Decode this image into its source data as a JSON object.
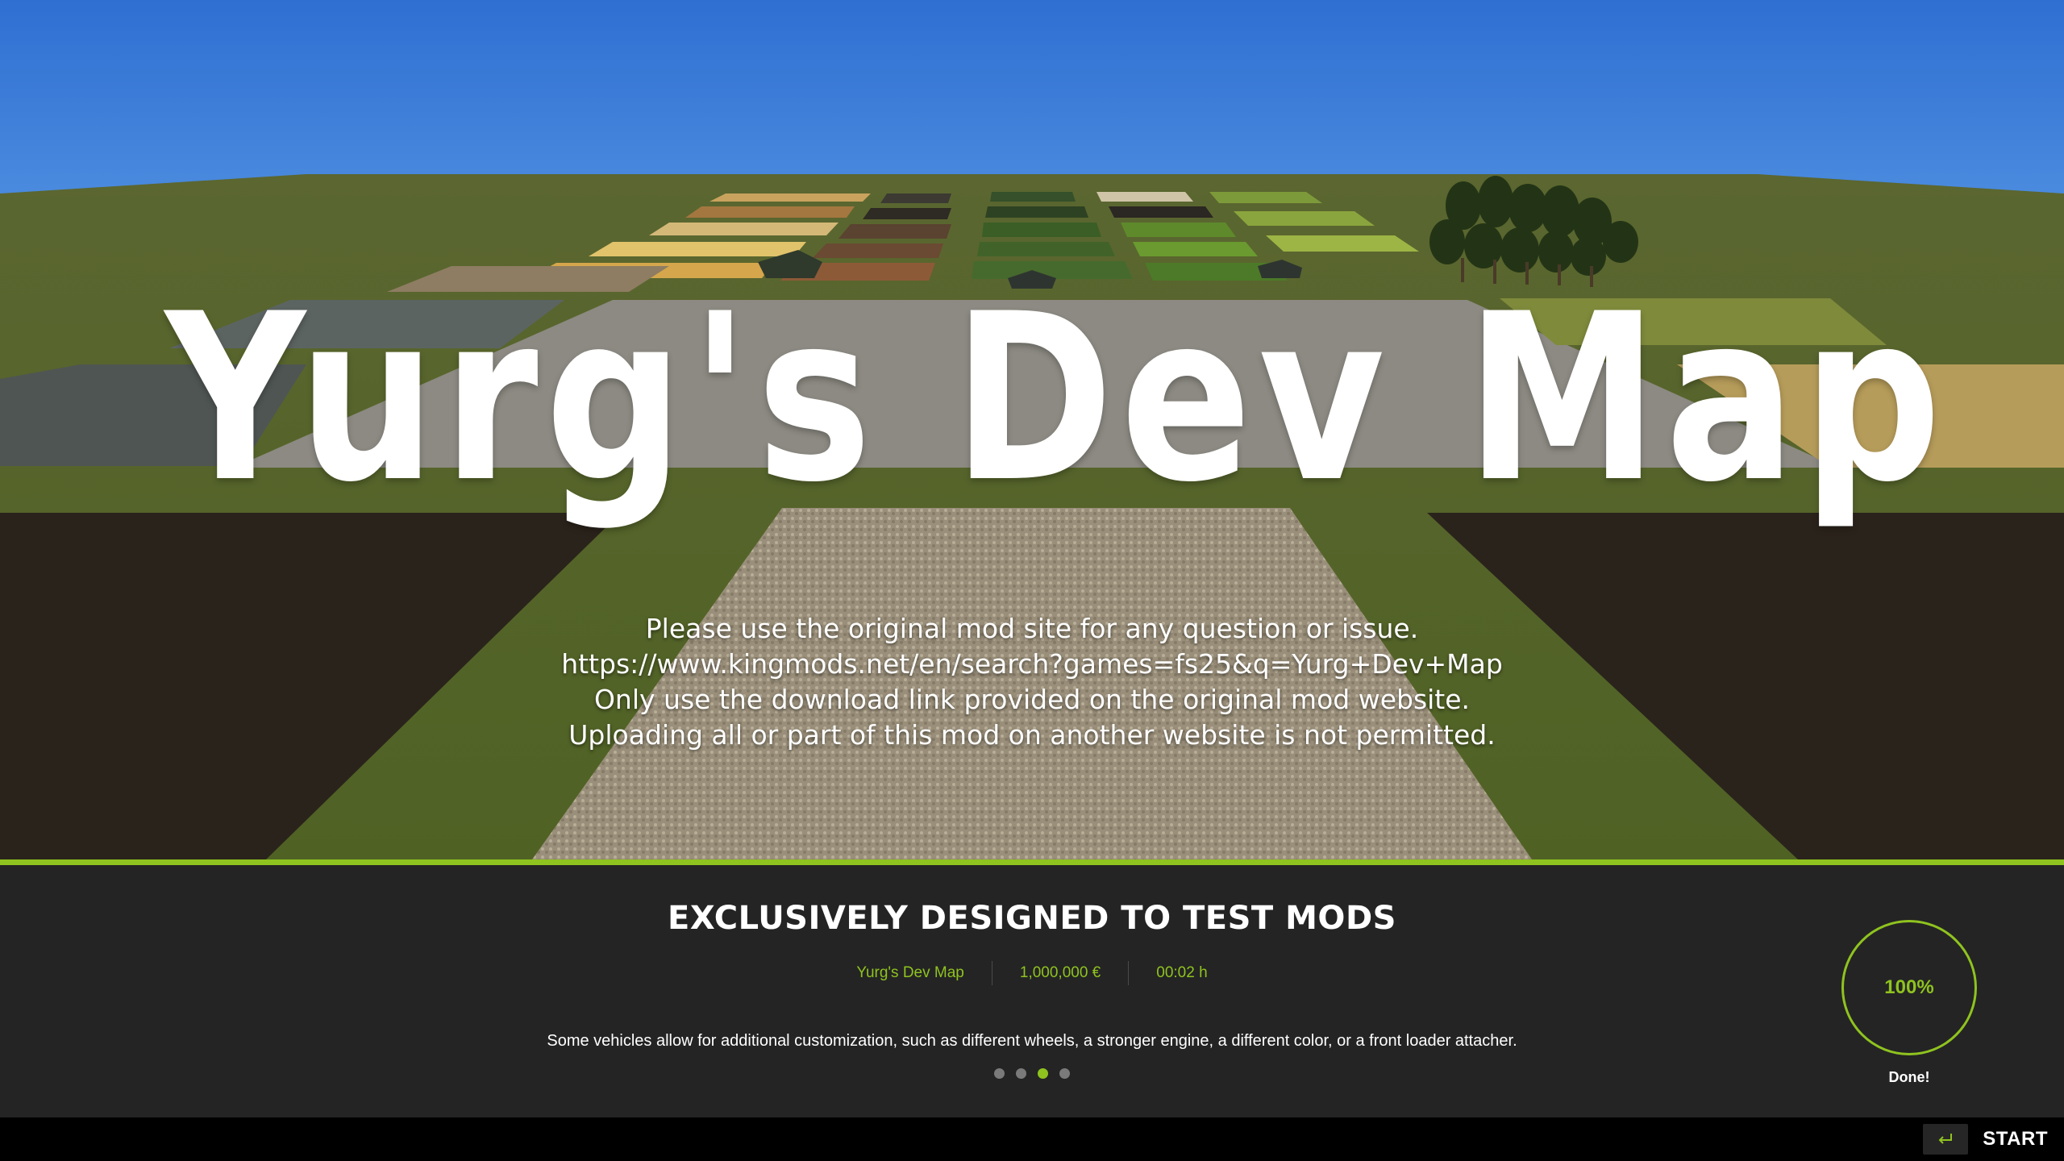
{
  "map_title": "Yurg's Dev Map",
  "notice": {
    "lines": [
      "Please use the original mod site for any question or issue.",
      "https://www.kingmods.net/en/search?games=fs25&q=Yurg+Dev+Map",
      "Only use the download link provided on the original mod website.",
      "Uploading all or part of this mod on another website is not permitted."
    ]
  },
  "loading": {
    "headline": "EXCLUSIVELY DESIGNED TO TEST MODS",
    "meta": {
      "map_name": "Yurg's Dev Map",
      "money": "1,000,000 €",
      "time": "00:02 h"
    },
    "tip": "Some vehicles allow for additional customization, such as different wheels, a stronger engine, a different color, or a front loader attacher.",
    "tip_pages": {
      "count": 4,
      "active": 3
    },
    "progress": {
      "percent_label": "100%",
      "value": 1.0,
      "status": "Done!"
    }
  },
  "footer": {
    "start_label": "START",
    "start_icon": "enter-key-icon"
  },
  "colors": {
    "accent": "#8fc31f",
    "panel": "#242424",
    "bottom_bar": "#000000",
    "sky": "#3f7fd8",
    "grass": "#5b6a2c"
  }
}
